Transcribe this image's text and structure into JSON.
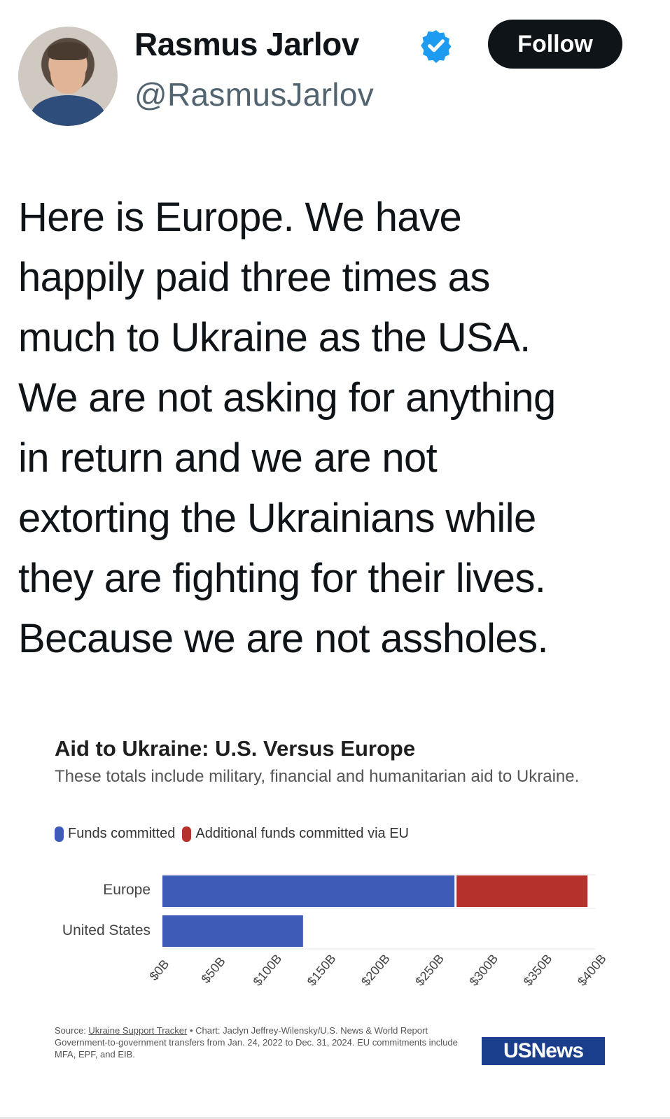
{
  "post": {
    "author_name": "Rasmus Jarlov",
    "handle": "@RasmusJarlov",
    "follow_label": "Follow",
    "verified_color": "#1d9bf0",
    "text_lines": [
      "Here is Europe. We have",
      "happily paid three times as",
      "much to Ukraine as the USA.",
      "We are not asking for anything",
      "in return and we are not",
      "extorting the Ukrainians while",
      "they are fighting for their lives.",
      "Because we are not assholes."
    ]
  },
  "chart": {
    "legend_committed": "Funds committed",
    "legend_eu": "Additional funds committed via EU",
    "source_prefix": "Source: ",
    "source_link": "Ukraine Support Tracker",
    "source_rest": " • Chart: Jaclyn Jeffrey-Wilensky/U.S. News & World Report",
    "note": "Government-to-government transfers from Jan. 24, 2022 to Dec. 31, 2024. EU commitments include MFA, EPF, and EIB.",
    "logo_text": "USNews"
  },
  "chart_data": {
    "type": "bar",
    "orientation": "horizontal",
    "stacked": true,
    "title": "Aid to Ukraine: U.S. Versus Europe",
    "subtitle": "These totals include military, financial and humanitarian aid to Ukraine.",
    "categories": [
      "Europe",
      "United States"
    ],
    "series": [
      {
        "name": "Funds committed",
        "color": "#3e5bb7",
        "values": [
          270,
          130
        ]
      },
      {
        "name": "Additional funds committed via EU",
        "color": "#b5312b",
        "values": [
          123,
          0
        ]
      }
    ],
    "xlim": [
      0,
      400
    ],
    "xticks": [
      "$0B",
      "$50B",
      "$100B",
      "$150B",
      "$200B",
      "$250B",
      "$300B",
      "$350B",
      "$400B"
    ],
    "grid": true,
    "legend_position": "top-left"
  }
}
